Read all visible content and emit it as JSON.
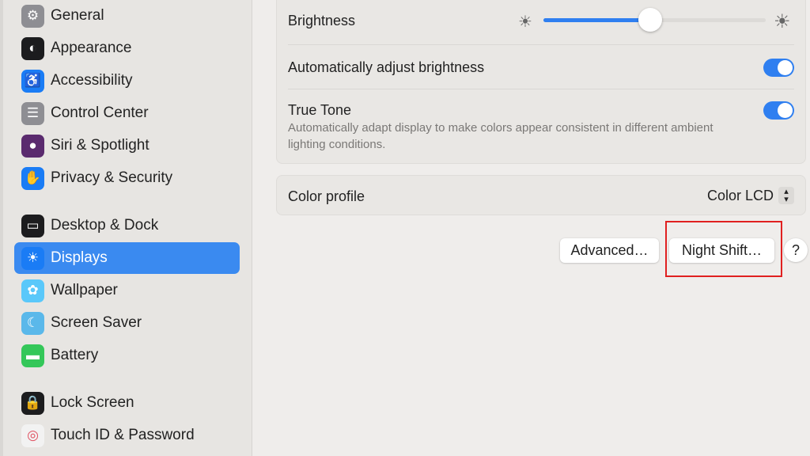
{
  "sidebar": {
    "items": [
      {
        "label": "General",
        "icon": "gear-icon",
        "color": "#8e8e93"
      },
      {
        "label": "Appearance",
        "icon": "appearance-icon",
        "color": "#1c1c1e"
      },
      {
        "label": "Accessibility",
        "icon": "accessibility-icon",
        "color": "#1a7cf5"
      },
      {
        "label": "Control Center",
        "icon": "control-center-icon",
        "color": "#8e8e93"
      },
      {
        "label": "Siri & Spotlight",
        "icon": "siri-icon",
        "color": "#5a2a6e"
      },
      {
        "label": "Privacy & Security",
        "icon": "hand-icon",
        "color": "#1a7cf5"
      },
      {
        "label": "Desktop & Dock",
        "icon": "dock-icon",
        "color": "#1c1c1e"
      },
      {
        "label": "Displays",
        "icon": "sun-icon",
        "color": "#1a7cf5",
        "selected": true
      },
      {
        "label": "Wallpaper",
        "icon": "flower-icon",
        "color": "#5ac8fa"
      },
      {
        "label": "Screen Saver",
        "icon": "screen-saver-icon",
        "color": "#5ab8ea"
      },
      {
        "label": "Battery",
        "icon": "battery-icon",
        "color": "#34c759"
      },
      {
        "label": "Lock Screen",
        "icon": "lock-icon",
        "color": "#1c1c1e"
      },
      {
        "label": "Touch ID & Password",
        "icon": "fingerprint-icon",
        "color": "#f2f2f2"
      }
    ]
  },
  "display": {
    "brightness_label": "Brightness",
    "brightness_value": 0.48,
    "auto_brightness_label": "Automatically adjust brightness",
    "auto_brightness_on": true,
    "true_tone_label": "True Tone",
    "true_tone_desc": "Automatically adapt display to make colors appear consistent in different ambient lighting conditions.",
    "true_tone_on": true,
    "color_profile_label": "Color profile",
    "color_profile_value": "Color LCD"
  },
  "buttons": {
    "advanced": "Advanced…",
    "night_shift": "Night Shift…",
    "help": "?"
  },
  "accent": "#2f7ff0",
  "highlight_color": "#e02020"
}
